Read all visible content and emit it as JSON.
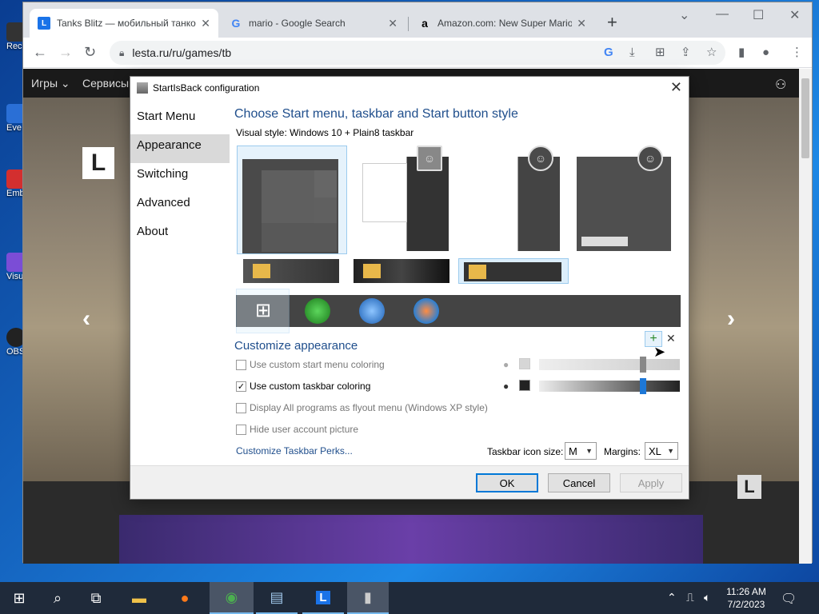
{
  "desktop": {
    "icons": [
      {
        "label": "Rec",
        "color": "#333333"
      },
      {
        "label": "Eve",
        "color": "#2a6fd6"
      },
      {
        "label": "Emb De",
        "color": "#d32f2f"
      },
      {
        "label": "Visu",
        "color": "#7b4dd6"
      },
      {
        "label": "OBS",
        "color": "#222222"
      }
    ]
  },
  "browser": {
    "tabs": [
      {
        "title": "Tanks Blitz — мобильный танко",
        "favicon": "L",
        "favicon_color": "#1a73e8",
        "active": true
      },
      {
        "title": "mario - Google Search",
        "favicon": "G",
        "favicon_color": "#ffffff",
        "active": false
      },
      {
        "title": "Amazon.com: New Super Mario",
        "favicon": "a",
        "favicon_color": "#ffffff",
        "active": false
      }
    ],
    "new_tab": "+",
    "url": "lesta.ru/ru/games/tb",
    "window_controls": {
      "minimize": "—",
      "maximize": "☐",
      "close": "✕",
      "dropdown": "⌄"
    }
  },
  "site": {
    "nav": [
      {
        "label": "Игры ⌄"
      },
      {
        "label": "Сервисы"
      }
    ],
    "logo": "L",
    "badge": "L"
  },
  "dialog": {
    "title": "StartIsBack configuration",
    "nav": [
      "Start Menu",
      "Appearance",
      "Switching",
      "Advanced",
      "About"
    ],
    "selected_nav": "Appearance",
    "heading": "Choose Start menu, taskbar and Start button style",
    "visual_style_label": "Visual style:",
    "visual_style_value": "Windows 10 + Plain8 taskbar",
    "customize_heading": "Customize appearance",
    "options": [
      {
        "label": "Use custom start menu coloring",
        "checked": false
      },
      {
        "label": "Use custom taskbar coloring",
        "checked": true
      },
      {
        "label": "Display All programs as flyout menu (Windows XP style)",
        "checked": false
      },
      {
        "label": "Hide user account picture",
        "checked": false
      }
    ],
    "perks_link": "Customize Taskbar Perks...",
    "icon_size_label": "Taskbar icon size:",
    "icon_size_value": "M",
    "margins_label": "Margins:",
    "margins_value": "XL",
    "buttons": {
      "ok": "OK",
      "cancel": "Cancel",
      "apply": "Apply"
    },
    "start_menu_color_level": 0.75,
    "taskbar_color_level": 0.75
  },
  "taskbar": {
    "time": "11:26 AM",
    "date": "7/2/2023"
  }
}
